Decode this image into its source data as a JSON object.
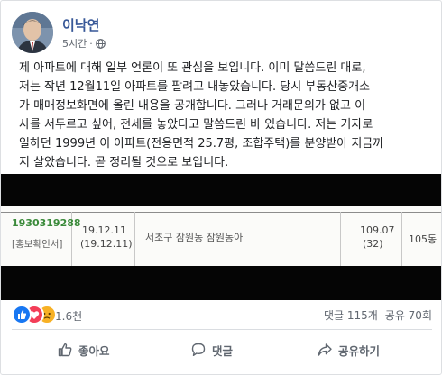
{
  "post": {
    "author": "이낙연",
    "time": "5시간",
    "visibility_icon": "globe-icon",
    "text_lines": [
      "제 아파트에 대해 일부 언론이 또 관심을 보입니다. 이미 말씀드린 대로,",
      "저는 작년 12월11일 아파트를 팔려고 내놓았습니다. 당시 부동산중개소",
      "가 매매정보화면에 올린 내용을 공개합니다. 그러나 거래문의가 없고 이",
      "사를 서두르고 싶어, 전세를 놓았다고 말씀드린 바 있습니다. 저는 기자로",
      "일하던 1999년 이 아파트(전용면적 25.7평, 조합주택)를 분양받아 지금까",
      "지 살았습니다. 곧 정리될 것으로 보입니다."
    ]
  },
  "listing": {
    "registration_no": "1930319288",
    "confirm_tag": "[홍보확인서]",
    "date_1": "19.12.11",
    "date_2": "(19.12.11)",
    "address": "서초구 잠원동 잠원동아",
    "area_1": "109.07",
    "area_2": "(32)",
    "building": "105동"
  },
  "stats": {
    "reaction_count": "1.6천",
    "comments": "댓글 115개",
    "shares": "공유 70회"
  },
  "actions": {
    "like": "좋아요",
    "comment": "댓글",
    "share": "공유하기"
  },
  "colors": {
    "author_link": "#385898",
    "like_blue": "#1877f2",
    "love_red": "#f33e58",
    "sad_yellow": "#f7b125",
    "registration_green": "#3a8a3a"
  }
}
